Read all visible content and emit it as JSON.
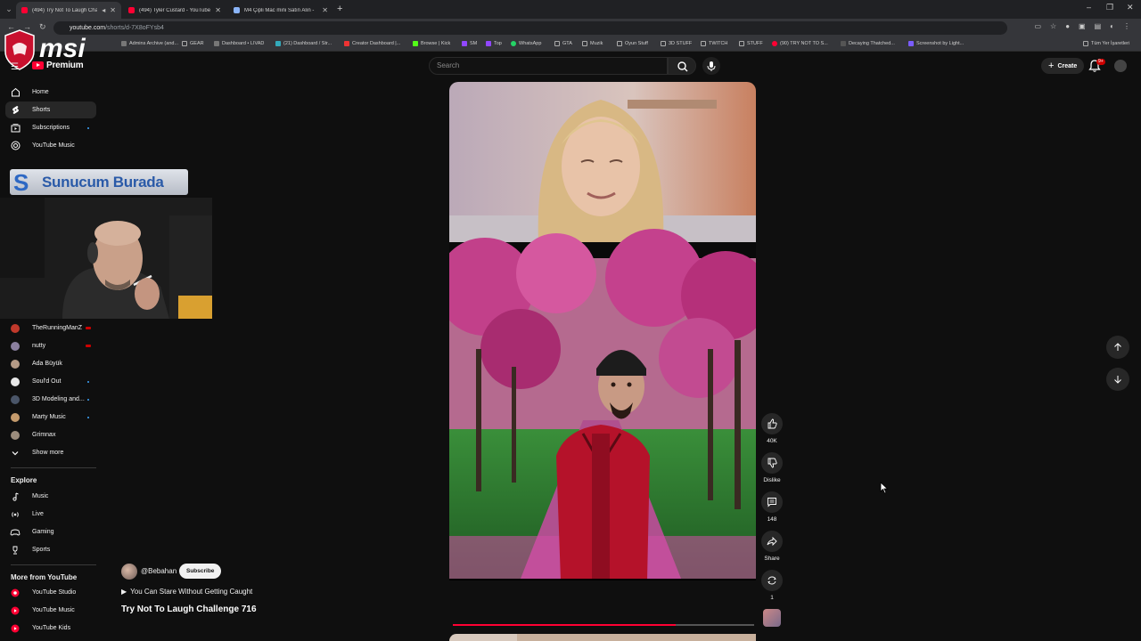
{
  "browser": {
    "tabs": [
      {
        "title": "(494) Try Not To Laugh Chall...",
        "active": true
      },
      {
        "title": "(494) Tyler Custard - YouTube",
        "active": false
      },
      {
        "title": "M4 Çipli Mac mini Satın Alın -",
        "active": false
      }
    ],
    "url": {
      "host": "youtube.com",
      "path": "/shorts/d-7X8oFYsb4"
    },
    "bookmarks": [
      "Admins Archive (and...",
      "GEAR",
      "Dashboard • LIVAD",
      "(21) Dashboard / Str...",
      "Creator Dashboard |...",
      "Browse | Kick",
      "SM",
      "Top",
      "WhatsApp",
      "GTA",
      "Muzik",
      "Oyun Stuff",
      "3D STUFF",
      "TWITCH",
      "STUFF",
      "(90) TRY NOT TO S...",
      "Decaying Thatched...",
      "Screenshot by Light...",
      "Tüm Yer İşaretleri"
    ]
  },
  "overlay": {
    "brand": "msi",
    "sponsor_text": "Sunucum Burada"
  },
  "header": {
    "logo_text": "Premium",
    "search_placeholder": "Search",
    "create_label": "Create",
    "notification_count": "9+"
  },
  "sidebar": {
    "main": [
      {
        "label": "Home",
        "icon": "home-icon"
      },
      {
        "label": "Shorts",
        "icon": "shorts-icon",
        "selected": true
      },
      {
        "label": "Subscriptions",
        "icon": "subscriptions-icon",
        "dot": true
      },
      {
        "label": "YouTube Music",
        "icon": "music-icon"
      }
    ],
    "subscriptions": [
      {
        "label": "TheRunningManZ",
        "live": true,
        "color": "#c0392b"
      },
      {
        "label": "nutty",
        "live": true,
        "color": "#8a7f9e"
      },
      {
        "label": "Ada Büyük",
        "live": false,
        "color": "#b59a86"
      },
      {
        "label": "Soul'd Out",
        "live": false,
        "dot": true,
        "color": "#e8e8e8"
      },
      {
        "label": "3D Modeling and...",
        "live": false,
        "dot": true,
        "color": "#4a5568"
      },
      {
        "label": "Marty Music",
        "live": false,
        "dot": true,
        "color": "#c49a6c"
      },
      {
        "label": "Grimnax",
        "live": false,
        "color": "#9b8c7c"
      }
    ],
    "show_more": "Show more",
    "explore_title": "Explore",
    "explore": [
      {
        "label": "Music",
        "icon": "music-note-icon"
      },
      {
        "label": "Live",
        "icon": "live-icon"
      },
      {
        "label": "Gaming",
        "icon": "gaming-icon"
      },
      {
        "label": "Sports",
        "icon": "trophy-icon"
      }
    ],
    "more_title": "More from YouTube",
    "more": [
      {
        "label": "YouTube Studio"
      },
      {
        "label": "YouTube Music"
      },
      {
        "label": "YouTube Kids"
      }
    ]
  },
  "short": {
    "channel": "@Bebahan",
    "subscribe_label": "Subscribe",
    "song": "You Can Stare Without Getting Caught",
    "title": "Try Not To Laugh Challenge 716",
    "progress": 0.74,
    "actions": {
      "likes": "40K",
      "dislike": "Dislike",
      "comments": "148",
      "share": "Share",
      "remix": "1"
    }
  }
}
